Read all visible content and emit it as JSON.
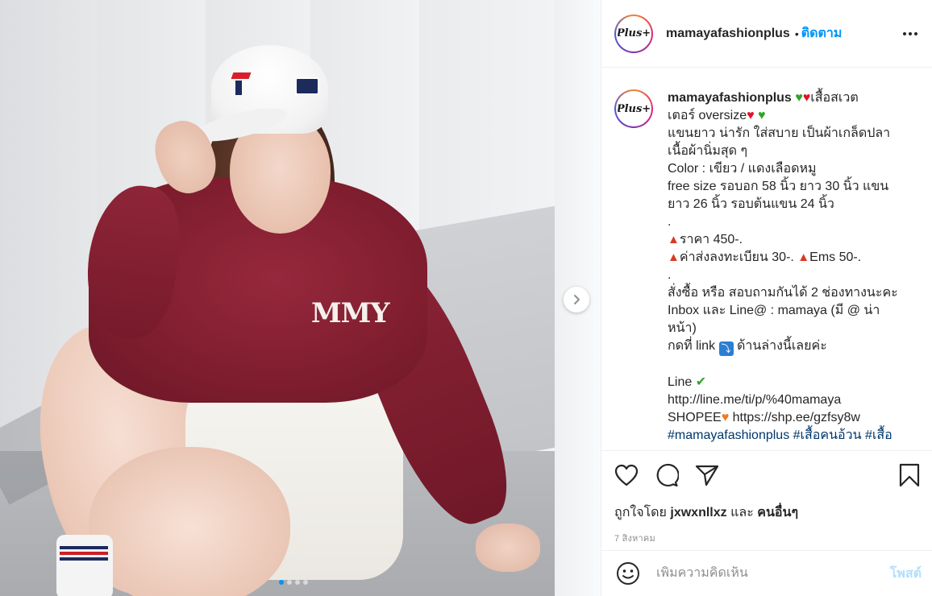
{
  "post": {
    "username": "mamayafashionplus",
    "separator": "•",
    "follow_label": "ติดตาม",
    "avatar_text": "Plus+",
    "more_icon": "more-horizontal-icon"
  },
  "photo": {
    "print_text": "MMY",
    "carousel": {
      "total": 4,
      "active_index": 0
    }
  },
  "caption": {
    "username": "mamayafashionplus",
    "lines": [
      "เสื้อสเวต",
      "เตอร์ oversize",
      "แขนยาว น่ารัก ใส่สบาย เป็นผ้าเกล็ดปลา",
      "เนื้อผ้านิ่มสุด ๆ",
      "Color : เขียว / แดงเลือดหมู",
      "free size รอบอก 58 นิ้ว ยาว 30 นิ้ว แขน",
      "ยาว 26 นิ้ว รอบต้นแขน 24 นิ้ว",
      ".",
      "ราคา 450-.",
      "ค่าส่งลงทะเบียน 30-.",
      "Ems 50-.",
      ".",
      "สั่งซื้อ หรือ สอบถามกันได้ 2 ช่องทางนะคะ",
      "Inbox และ Line@ : mamaya (มี @ น่า",
      "หน้า)",
      "กดที่ link",
      "ด้านล่างนี้เลยค่ะ",
      "Line",
      "http://line.me/ti/p/%40mamaya",
      "SHOPEE",
      "https://shp.ee/gzfsy8w",
      "#mamayafashionplus",
      "#เสื้อคนอ้วน",
      "#เสื้อ"
    ],
    "down_arrow_glyph": "⤵"
  },
  "actions": {
    "likes_prefix": "ถูกใจโดย",
    "likes_user": "jxwxnllxz",
    "likes_and": "และ",
    "likes_others": "คนอื่นๆ",
    "date": "7 สิงหาคม"
  },
  "comment": {
    "placeholder": "เพิ่มความคิดเห็น",
    "post_label": "โพสต์"
  },
  "colors": {
    "accent": "#0095f6",
    "post_disabled": "#b2dffc",
    "hashtag": "#00376b",
    "sweater": "#7e1d2e"
  }
}
